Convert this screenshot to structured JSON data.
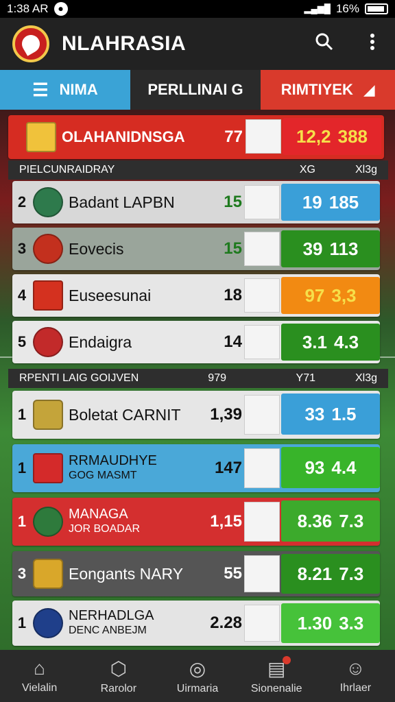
{
  "status_bar": {
    "time": "1:38 AR",
    "battery": "16%"
  },
  "app_bar": {
    "title": "NLAHRASIA"
  },
  "tabs": [
    {
      "label": "NIMA"
    },
    {
      "label": "PERLLINAI G"
    },
    {
      "label": "RIMTIYEK"
    }
  ],
  "featured": {
    "team": "OLAHANIDNSGA",
    "pts": "77",
    "s1": "12,2",
    "s2": "388",
    "color": "#d62c22",
    "score_color": "#e3262a"
  },
  "section1": {
    "title": "PIELCUNRAIDRAY",
    "col1": "XG",
    "col2": "Xl3g"
  },
  "group1": [
    {
      "rank": "2",
      "team": "Badant LAPBN",
      "pts": "15",
      "s1": "19",
      "s2": "185",
      "row": "#d8d8d8",
      "score": "#3a9fd8",
      "crest": "#2e7a4c"
    },
    {
      "rank": "3",
      "team": "Eovecis",
      "pts": "15",
      "s1": "39",
      "s2": "113",
      "row": "#9aa59b",
      "score": "#2a8f1f",
      "crest": "#c3301e"
    },
    {
      "rank": "4",
      "team": "Euseesunai",
      "pts": "18",
      "s1": "97",
      "s2": "3,3",
      "row": "#e6e6e6",
      "score": "#f28a12",
      "crest": "#d4311f"
    },
    {
      "rank": "5",
      "team": "Endaigra",
      "pts": "14",
      "s1": "3.1",
      "s2": "4.3",
      "row": "#e8e8e8",
      "score": "#2a8f1f",
      "crest": "#c22a2a"
    }
  ],
  "section2": {
    "title": "RPENTI LAIG GOIJVEN",
    "col0": "979",
    "col1": "Y71",
    "col2": "Xl3g"
  },
  "group2": [
    {
      "rank": "1",
      "team": "Boletat CARNIT",
      "team2": "",
      "pts": "1,39",
      "s1": "33",
      "s2": "1.5",
      "row": "#e6e6e6",
      "score": "#3a9fd8",
      "crest": "#c4a43a"
    },
    {
      "rank": "1",
      "team": "RRMAUDHYE",
      "team2": "GOG MASMT",
      "pts": "147",
      "s1": "93",
      "s2": "4.4",
      "row": "#4aa8d8",
      "score": "#38b42a",
      "crest": "#d42a2a"
    },
    {
      "rank": "1",
      "team": "MANAGA",
      "team2": "JOR BOADAR",
      "pts": "1,15",
      "s1": "8.36",
      "s2": "7.3",
      "row": "#d42f2f",
      "score": "#3caa2c",
      "crest": "#2e7a3c"
    },
    {
      "rank": "3",
      "team": "Eongants NARY",
      "team2": "",
      "pts": "55",
      "s1": "8.21",
      "s2": "7.3",
      "row": "#555555",
      "score": "#2a8f1f",
      "crest": "#d9a72a"
    },
    {
      "rank": "1",
      "team": "NERHADLGA",
      "team2": "DENC ANBEJM",
      "pts": "2.28",
      "s1": "1.30",
      "s2": "3.3",
      "row": "#e4e4e4",
      "score": "#46c23a",
      "crest": "#1f3f8a"
    }
  ],
  "bottom_nav": [
    {
      "label": "Vielalin",
      "icon": "home-icon"
    },
    {
      "label": "Rarolor",
      "icon": "shield-icon"
    },
    {
      "label": "Uirmaria",
      "icon": "whistle-icon"
    },
    {
      "label": "Sionenalie",
      "icon": "inbox-icon"
    },
    {
      "label": "Ihrlaer",
      "icon": "user-icon"
    }
  ]
}
